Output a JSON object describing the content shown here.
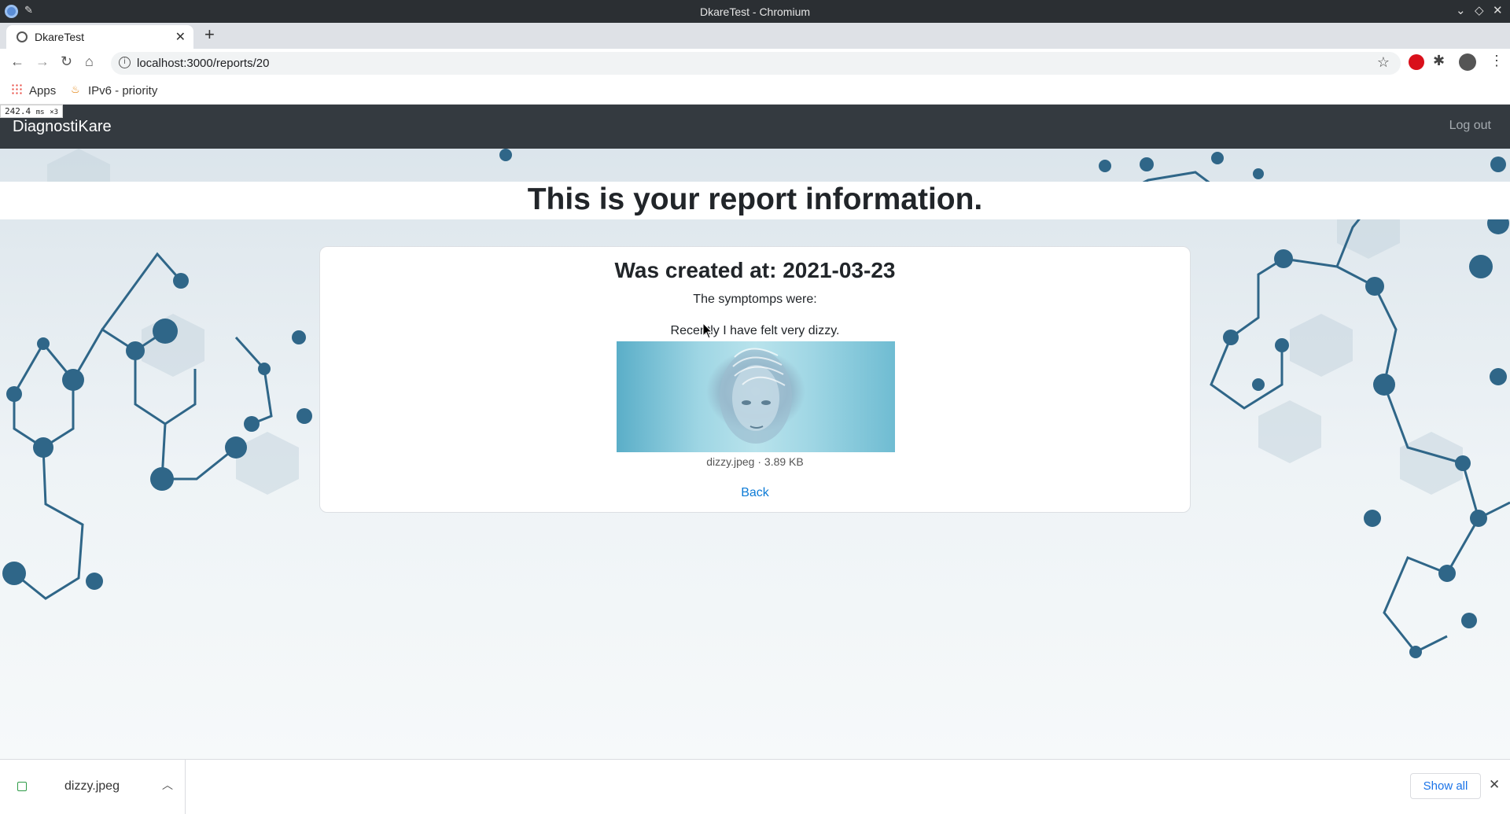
{
  "window": {
    "title": "DkareTest - Chromium"
  },
  "tabs": [
    {
      "title": "DkareTest"
    }
  ],
  "toolbar": {
    "url": "localhost:3000/reports/20"
  },
  "bookmarks": [
    {
      "label": "Apps"
    },
    {
      "label": "IPv6 - priority"
    }
  ],
  "timing_overlay": {
    "value": "242.4",
    "unit": "ms",
    "suffix": "×3"
  },
  "app_nav": {
    "brand": "DiagnostiKare",
    "logout": "Log out"
  },
  "page": {
    "heading": "This is your report information.",
    "created": "Was created at: 2021-03-23",
    "symptoms_label": "The symptomps were:",
    "symptoms_text": "Recently I have felt very dizzy.",
    "attachment_caption": "dizzy.jpeg · 3.89 KB",
    "back_label": "Back"
  },
  "downloads": {
    "file_name": "dizzy.jpeg",
    "show_all": "Show all"
  },
  "colors": {
    "nav_bg": "#343a40",
    "link": "#0d7bd6",
    "molecule": "#2f6688"
  }
}
